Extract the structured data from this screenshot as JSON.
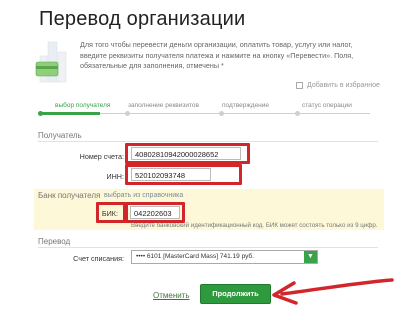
{
  "page": {
    "title": "Перевод организации",
    "intro_text": "Для того чтобы перевести деньги организации, оплатить товар, услугу или налог, введите реквизиты получателя платежа и нажмите на кнопку «Перевести». Поля, обязательные для заполнения, отмечены *",
    "favorites_label": "Добавить в избранное"
  },
  "steps": [
    {
      "label": "выбор получателя",
      "active": true
    },
    {
      "label": "заполнение реквизитов",
      "active": false
    },
    {
      "label": "подтверждение",
      "active": false
    },
    {
      "label": "статус операции",
      "active": false
    }
  ],
  "recipient": {
    "section_title": "Получатель",
    "account_label": "Номер счета:",
    "account_value": "40802810942000028652",
    "inn_label": "ИНН:",
    "inn_value": "520102093748"
  },
  "bank": {
    "section_title": "Банк получателя",
    "choose_link": "выбрать из справочника",
    "bik_label": "БИК:",
    "bik_value": "042202603",
    "bik_hint": "Введите банковский идентификационный код. БИК может состоять только из 9 цифр."
  },
  "transfer": {
    "section_title": "Перевод",
    "debit_label": "Счет списания:",
    "debit_value": "•••• 6101 [MasterCard Mass] 741.19 руб."
  },
  "actions": {
    "cancel_label": "Отменить",
    "continue_label": "Продолжить"
  },
  "colors": {
    "accent_green": "#2e9a3e",
    "highlight_red": "#d3262b",
    "bank_band": "#fdf8d8"
  }
}
